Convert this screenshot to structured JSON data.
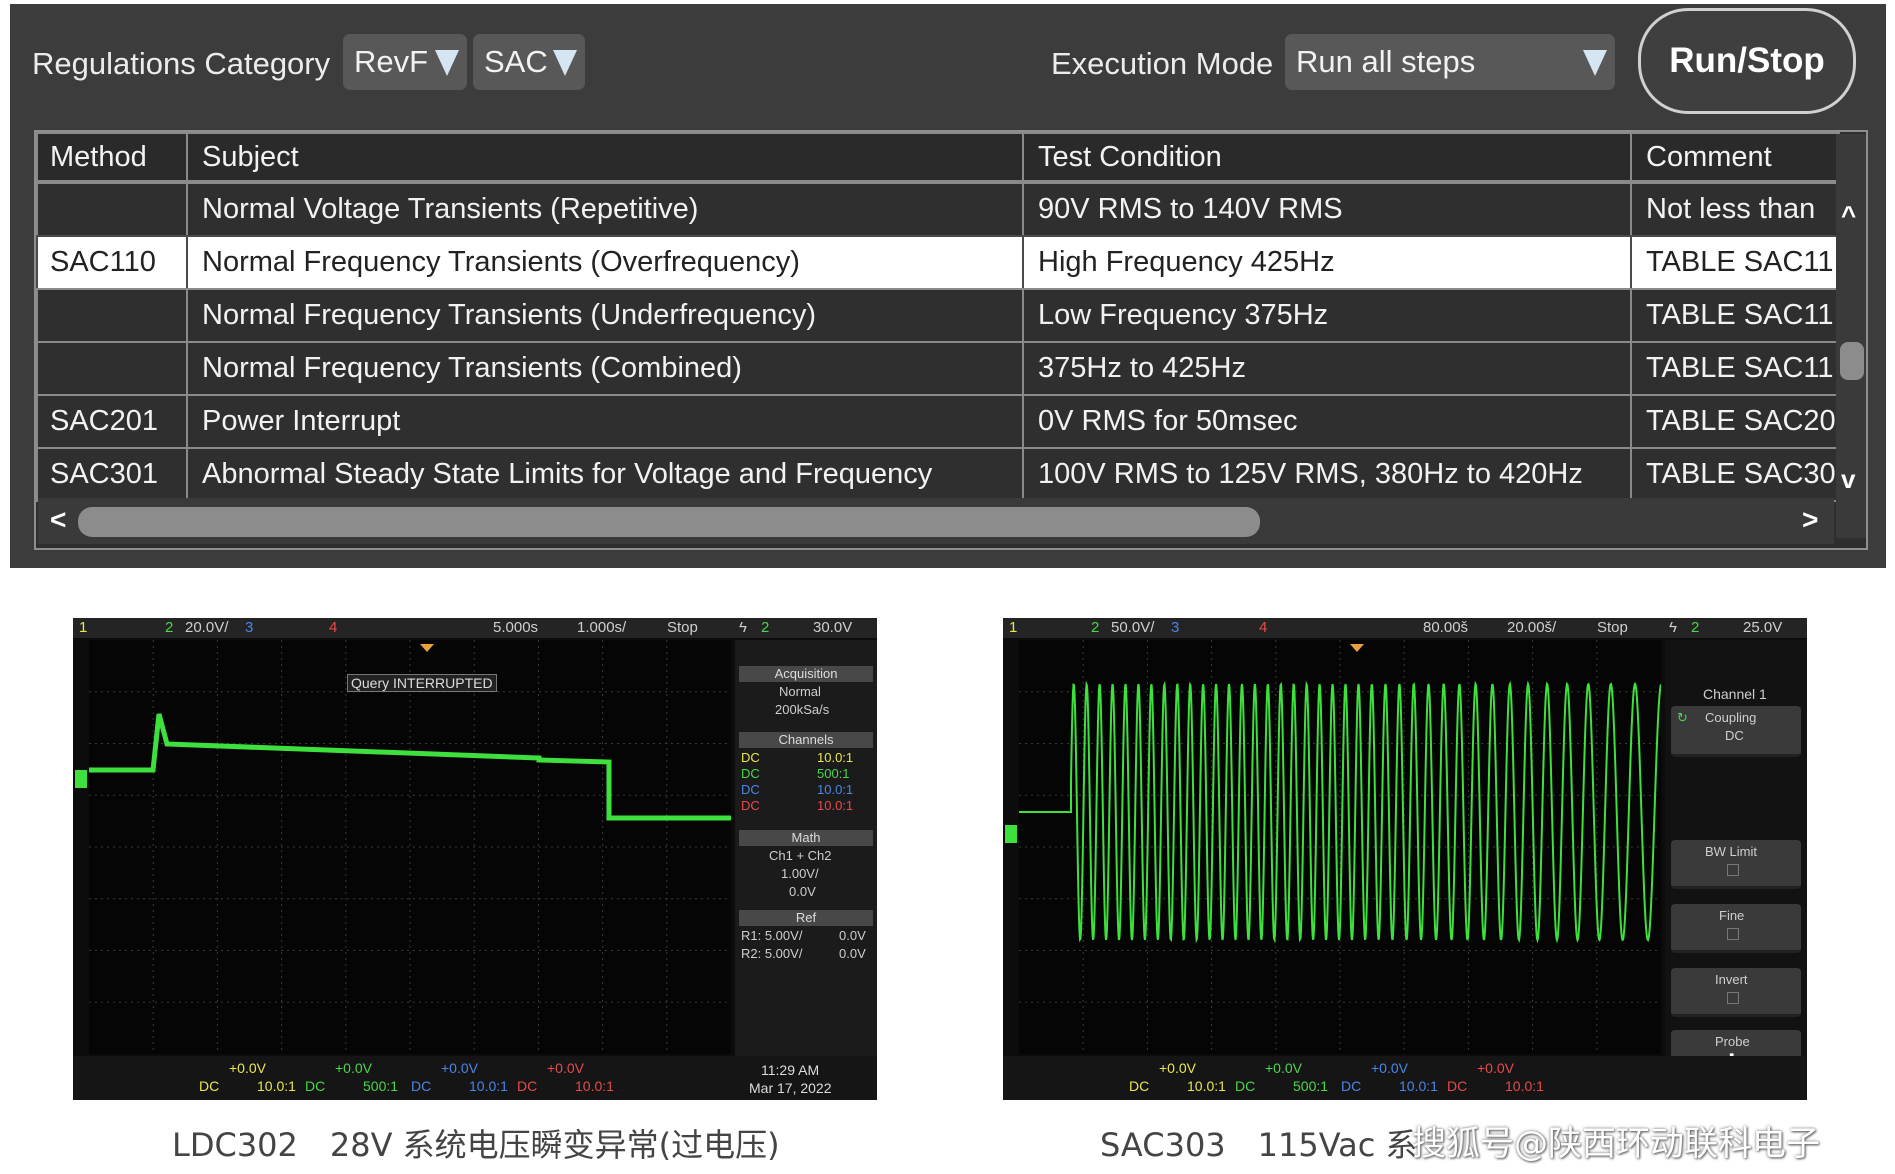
{
  "toolbar": {
    "regulations_label": "Regulations Category",
    "rev_value": "RevF",
    "category_value": "SAC",
    "execution_label": "Execution Mode",
    "execution_value": "Run all steps",
    "run_stop_label": "Run/Stop"
  },
  "table": {
    "headers": [
      "Method",
      "Subject",
      "Test Condition",
      "Comment"
    ],
    "rows": [
      {
        "method": "",
        "subject": "Normal Voltage Transients (Repetitive)",
        "condition": "90V RMS to 140V RMS",
        "comment": "Not less than"
      },
      {
        "method": "SAC110",
        "subject": "Normal Frequency Transients (Overfrequency)",
        "condition": "High Frequency 425Hz",
        "comment": "TABLE SAC11"
      },
      {
        "method": "",
        "subject": "Normal Frequency Transients (Underfrequency)",
        "condition": "Low Frequency 375Hz",
        "comment": "TABLE SAC11"
      },
      {
        "method": "",
        "subject": "Normal Frequency Transients (Combined)",
        "condition": "375Hz to 425Hz",
        "comment": "TABLE SAC11"
      },
      {
        "method": "SAC201",
        "subject": "Power Interrupt",
        "condition": "0V RMS for 50msec",
        "comment": "TABLE SAC20"
      },
      {
        "method": "SAC301",
        "subject": "Abnormal Steady State Limits for Voltage and Frequency",
        "condition": "100V RMS to 125V RMS, 380Hz to 420Hz",
        "comment": "TABLE SAC30"
      }
    ],
    "selected_row": 1,
    "scroll_up": "^",
    "scroll_down": "v",
    "scroll_left": "<",
    "scroll_right": ">"
  },
  "scope1": {
    "top": {
      "ch1": "1",
      "ch2": "2",
      "volts": "20.0V/",
      "ch3": "3",
      "ch4": "4",
      "delay": "5.000s",
      "timebase": "1.000s/",
      "status": "Stop",
      "trig": "2",
      "trig_level": "30.0V"
    },
    "message": "Query INTERRUPTED",
    "acquisition": {
      "title": "Acquisition",
      "mode": "Normal",
      "rate": "200kSa/s"
    },
    "channels": {
      "title": "Channels",
      "rows": [
        {
          "coupling": "DC",
          "probe": "10.0:1",
          "color": "#e8e84a"
        },
        {
          "coupling": "DC",
          "probe": "500:1",
          "color": "#4ad64a"
        },
        {
          "coupling": "DC",
          "probe": "10.0:1",
          "color": "#4a86e8"
        },
        {
          "coupling": "DC",
          "probe": "10.0:1",
          "color": "#e84a4a"
        }
      ]
    },
    "math": {
      "title": "Math",
      "expr": "Ch1 + Ch2",
      "scale": "1.00V/",
      "offset": "0.0V"
    },
    "ref": {
      "title": "Ref",
      "r1": "R1:  5.00V/",
      "r1_off": "0.0V",
      "r2": "R2:  5.00V/",
      "r2_off": "0.0V"
    },
    "bottom": {
      "ch_offsets": [
        "+0.0V",
        "+0.0V",
        "+0.0V",
        "+0.0V"
      ],
      "ch_probes": [
        "10.0:1",
        "500:1",
        "10.0:1",
        "10.0:1"
      ],
      "coupling": "DC",
      "time": "11:29 AM",
      "date": "Mar 17, 2022"
    },
    "caption": "LDC302　28V 系统电压瞬变异常(过电压)"
  },
  "scope2": {
    "top": {
      "ch1": "1",
      "ch2": "2",
      "volts": "50.0V/",
      "ch3": "3",
      "ch4": "4",
      "delay": "80.00š",
      "timebase": "20.00š/",
      "status": "Stop",
      "trig": "2",
      "trig_level": "25.0V"
    },
    "menu": {
      "title": "Channel 1",
      "coupling_label": "Coupling",
      "coupling_value": "DC",
      "bw_limit": "BW Limit",
      "fine": "Fine",
      "invert": "Invert",
      "probe": "Probe"
    },
    "bottom": {
      "ch_offsets": [
        "+0.0V",
        "+0.0V",
        "+0.0V",
        "+0.0V"
      ],
      "ch_probes": [
        "10.0:1",
        "500:1",
        "10.0:1",
        "10.0:1"
      ],
      "coupling": "DC"
    },
    "caption": "SAC303　115Vac 系"
  },
  "watermark": "搜狐号@陕西环动联科电子",
  "colors": {
    "trace": "#3de03d",
    "panel_bg": "#3c3c3c",
    "accent_ch1": "#e8e84a",
    "accent_ch2": "#4ad64a",
    "accent_ch3": "#4a86e8",
    "accent_ch4": "#e84a4a"
  }
}
